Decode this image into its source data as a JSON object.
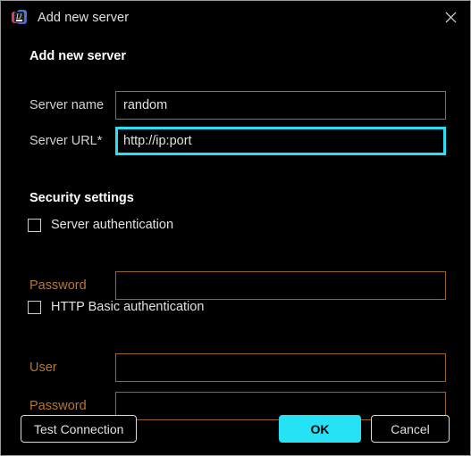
{
  "window": {
    "title": "Add new server",
    "icon": "intellij-idea-icon",
    "close_icon": "close-icon"
  },
  "sections": {
    "add_server": {
      "heading": "Add new server",
      "fields": [
        {
          "name": "server-name",
          "label": "Server name",
          "value": "random",
          "placeholder": "",
          "focused": false,
          "state": "normal"
        },
        {
          "name": "server-url",
          "label": "Server URL*",
          "value": "http://ip:port",
          "placeholder": "http://ip:port",
          "focused": true,
          "state": "normal"
        }
      ]
    },
    "security": {
      "heading": "Security settings",
      "server_auth": {
        "label": "Server authentication",
        "checked": false,
        "password": {
          "label": "Password",
          "value": "",
          "state": "warn"
        }
      },
      "http_basic_auth": {
        "label": "HTTP Basic authentication",
        "checked": false,
        "user": {
          "label": "User",
          "value": "",
          "state": "warn"
        },
        "password": {
          "label": "Password",
          "value": "",
          "state": "warn"
        }
      }
    }
  },
  "footer": {
    "test_connection": "Test Connection",
    "ok": "OK",
    "cancel": "Cancel"
  },
  "colors": {
    "accent_cyan": "#26e2f5",
    "warn_orange": "#b8762e",
    "text_primary": "#dfe1e5",
    "background": "#000000",
    "border": "#9a9a9a"
  }
}
